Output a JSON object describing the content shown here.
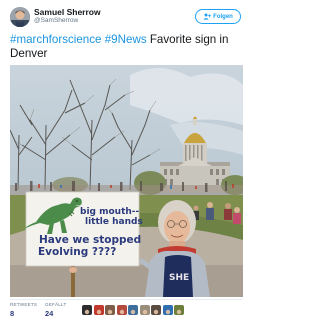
{
  "author": {
    "name": "Samuel Sherrow",
    "handle": "@SamSherrow"
  },
  "follow_button": {
    "label": "Folgen"
  },
  "tweet": {
    "tag1": "#marchforscience",
    "tag2": "#9News",
    "line1_rest": " Favorite sign in",
    "line2": "Denver"
  },
  "sign": {
    "line1": "big mouth--",
    "line2": "little hands",
    "line3": "Have we stopped",
    "line4": "Evolving ????"
  },
  "shirt_text": "SHE",
  "stats": {
    "retweets_label": "RETWEETS",
    "retweets_value": "8",
    "likes_label": "GEFÄLLT",
    "likes_value": "24"
  },
  "likers": [
    {
      "name": "liker-avatar",
      "color": "#2d2d2d"
    },
    {
      "name": "liker-avatar",
      "color": "#c0392b"
    },
    {
      "name": "liker-avatar",
      "color": "#7b5d48"
    },
    {
      "name": "liker-avatar",
      "color": "#b34a3c"
    },
    {
      "name": "liker-avatar",
      "color": "#3d6f9a"
    },
    {
      "name": "liker-avatar",
      "color": "#9a8e7a"
    },
    {
      "name": "liker-avatar",
      "color": "#5a4c42"
    },
    {
      "name": "liker-avatar",
      "color": "#2f6fb0"
    },
    {
      "name": "liker-avatar",
      "color": "#6b7f3a"
    }
  ]
}
